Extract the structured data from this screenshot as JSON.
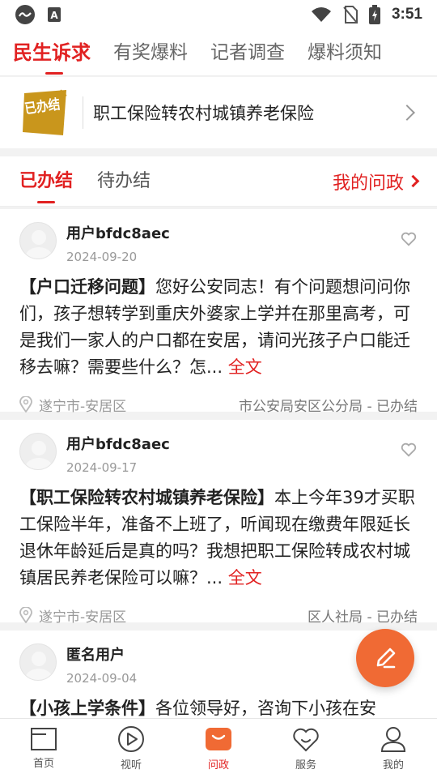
{
  "status_bar": {
    "time": "3:51",
    "notification_letter": "A"
  },
  "top_tabs": [
    {
      "label": "民生诉求",
      "active": true
    },
    {
      "label": "有奖爆料",
      "active": false
    },
    {
      "label": "记者调查",
      "active": false
    },
    {
      "label": "爆料须知",
      "active": false
    }
  ],
  "banner": {
    "badge_text": "已办结",
    "title": "职工保险转农村城镇养老保险"
  },
  "sub_tabs": [
    {
      "label": "已办结",
      "active": true
    },
    {
      "label": "待办结",
      "active": false
    }
  ],
  "my_inquiry": "我的问政",
  "posts": [
    {
      "user": "用户bfdc8aec",
      "date": "2024-09-20",
      "topic": "【户口迁移问题】",
      "body": "您好公安同志！有个问题想问问你们，孩子想转学到重庆外婆家上学并在那里高考，可是我们一家人的户口都在安居，请问光孩子户口能迁移去嘛？需要些什么？怎...",
      "more": "全文",
      "location": "遂宁市-安居区",
      "department": "市公安局安区公分局 - 已办结"
    },
    {
      "user": "用户bfdc8aec",
      "date": "2024-09-17",
      "topic": "【职工保险转农村城镇养老保险】",
      "body": "本上今年39才买职工保险半年，准备不上班了，听闻现在缴费年限延长退休年龄延后是真的吗？我想把职工保险转成农村城镇居民养老保险可以嘛？...",
      "more": "全文",
      "location": "遂宁市-安居区",
      "department": "区人社局 - 已办结"
    },
    {
      "user": "匿名用户",
      "date": "2024-09-04",
      "topic": "【小孩上学条件】",
      "body": "各位领导好，咨询下小孩在安"
    }
  ],
  "bottom_nav": [
    {
      "label": "首页",
      "icon": "home-icon",
      "active": false
    },
    {
      "label": "视听",
      "icon": "play-icon",
      "active": false
    },
    {
      "label": "问政",
      "icon": "inquiry-icon",
      "active": true
    },
    {
      "label": "服务",
      "icon": "heart-service-icon",
      "active": false
    },
    {
      "label": "我的",
      "icon": "user-icon",
      "active": false
    }
  ],
  "colors": {
    "accent": "#e12121",
    "fab": "#f06a34",
    "badge": "#c9961c"
  }
}
